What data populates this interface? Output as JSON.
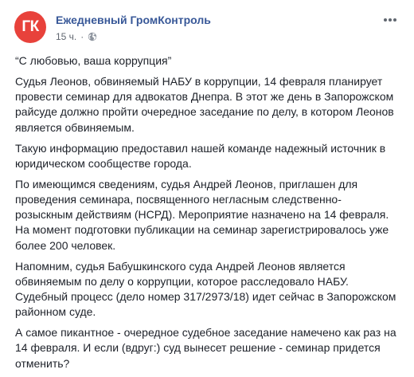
{
  "post": {
    "avatar_text": "ГК",
    "avatar_color": "#e8423b",
    "page_name": "Ежедневный ГромКонтроль",
    "time": "15 ч.",
    "meta_separator": "·",
    "privacy_icon": "globe-icon",
    "menu_icon": "more-horizontal-icon",
    "accent_color": "#385898",
    "paragraphs": [
      "“С любовью, ваша коррупция”",
      "Судья Леонов, обвиняемый НАБУ в коррупции, 14 февраля планирует провести семинар для адвокатов Днепра. В этот же день в Запорожском райсуде должно пройти очередное заседание по делу, в котором Леонов является обвиняемым.",
      "Такую информацию предоставил нашей команде надежный источник в юридическом сообществе города.",
      "По имеющимся сведениям, судья Андрей Леонов, приглашен для проведения семинара, посвященного негласным следственно-розыскным действиям (НСРД). Мероприятие назначено на 14 февраля. На момент подготовки публикации на семинар зарегистрировалось уже более 200 человек.",
      "Напомним, судья Бабушкинского суда Андрей Леонов является обвиняемым по делу о коррупции, которое расследовало НАБУ. Судебный процесс (дело номер 317/2973/18) идет сейчас в Запорожском районном суде.",
      "А самое пикантное - очередное судебное заседание намечено как раз на 14 февраля. И если (вдруг:) суд вынесет решение - семинар придется отменить?"
    ]
  }
}
